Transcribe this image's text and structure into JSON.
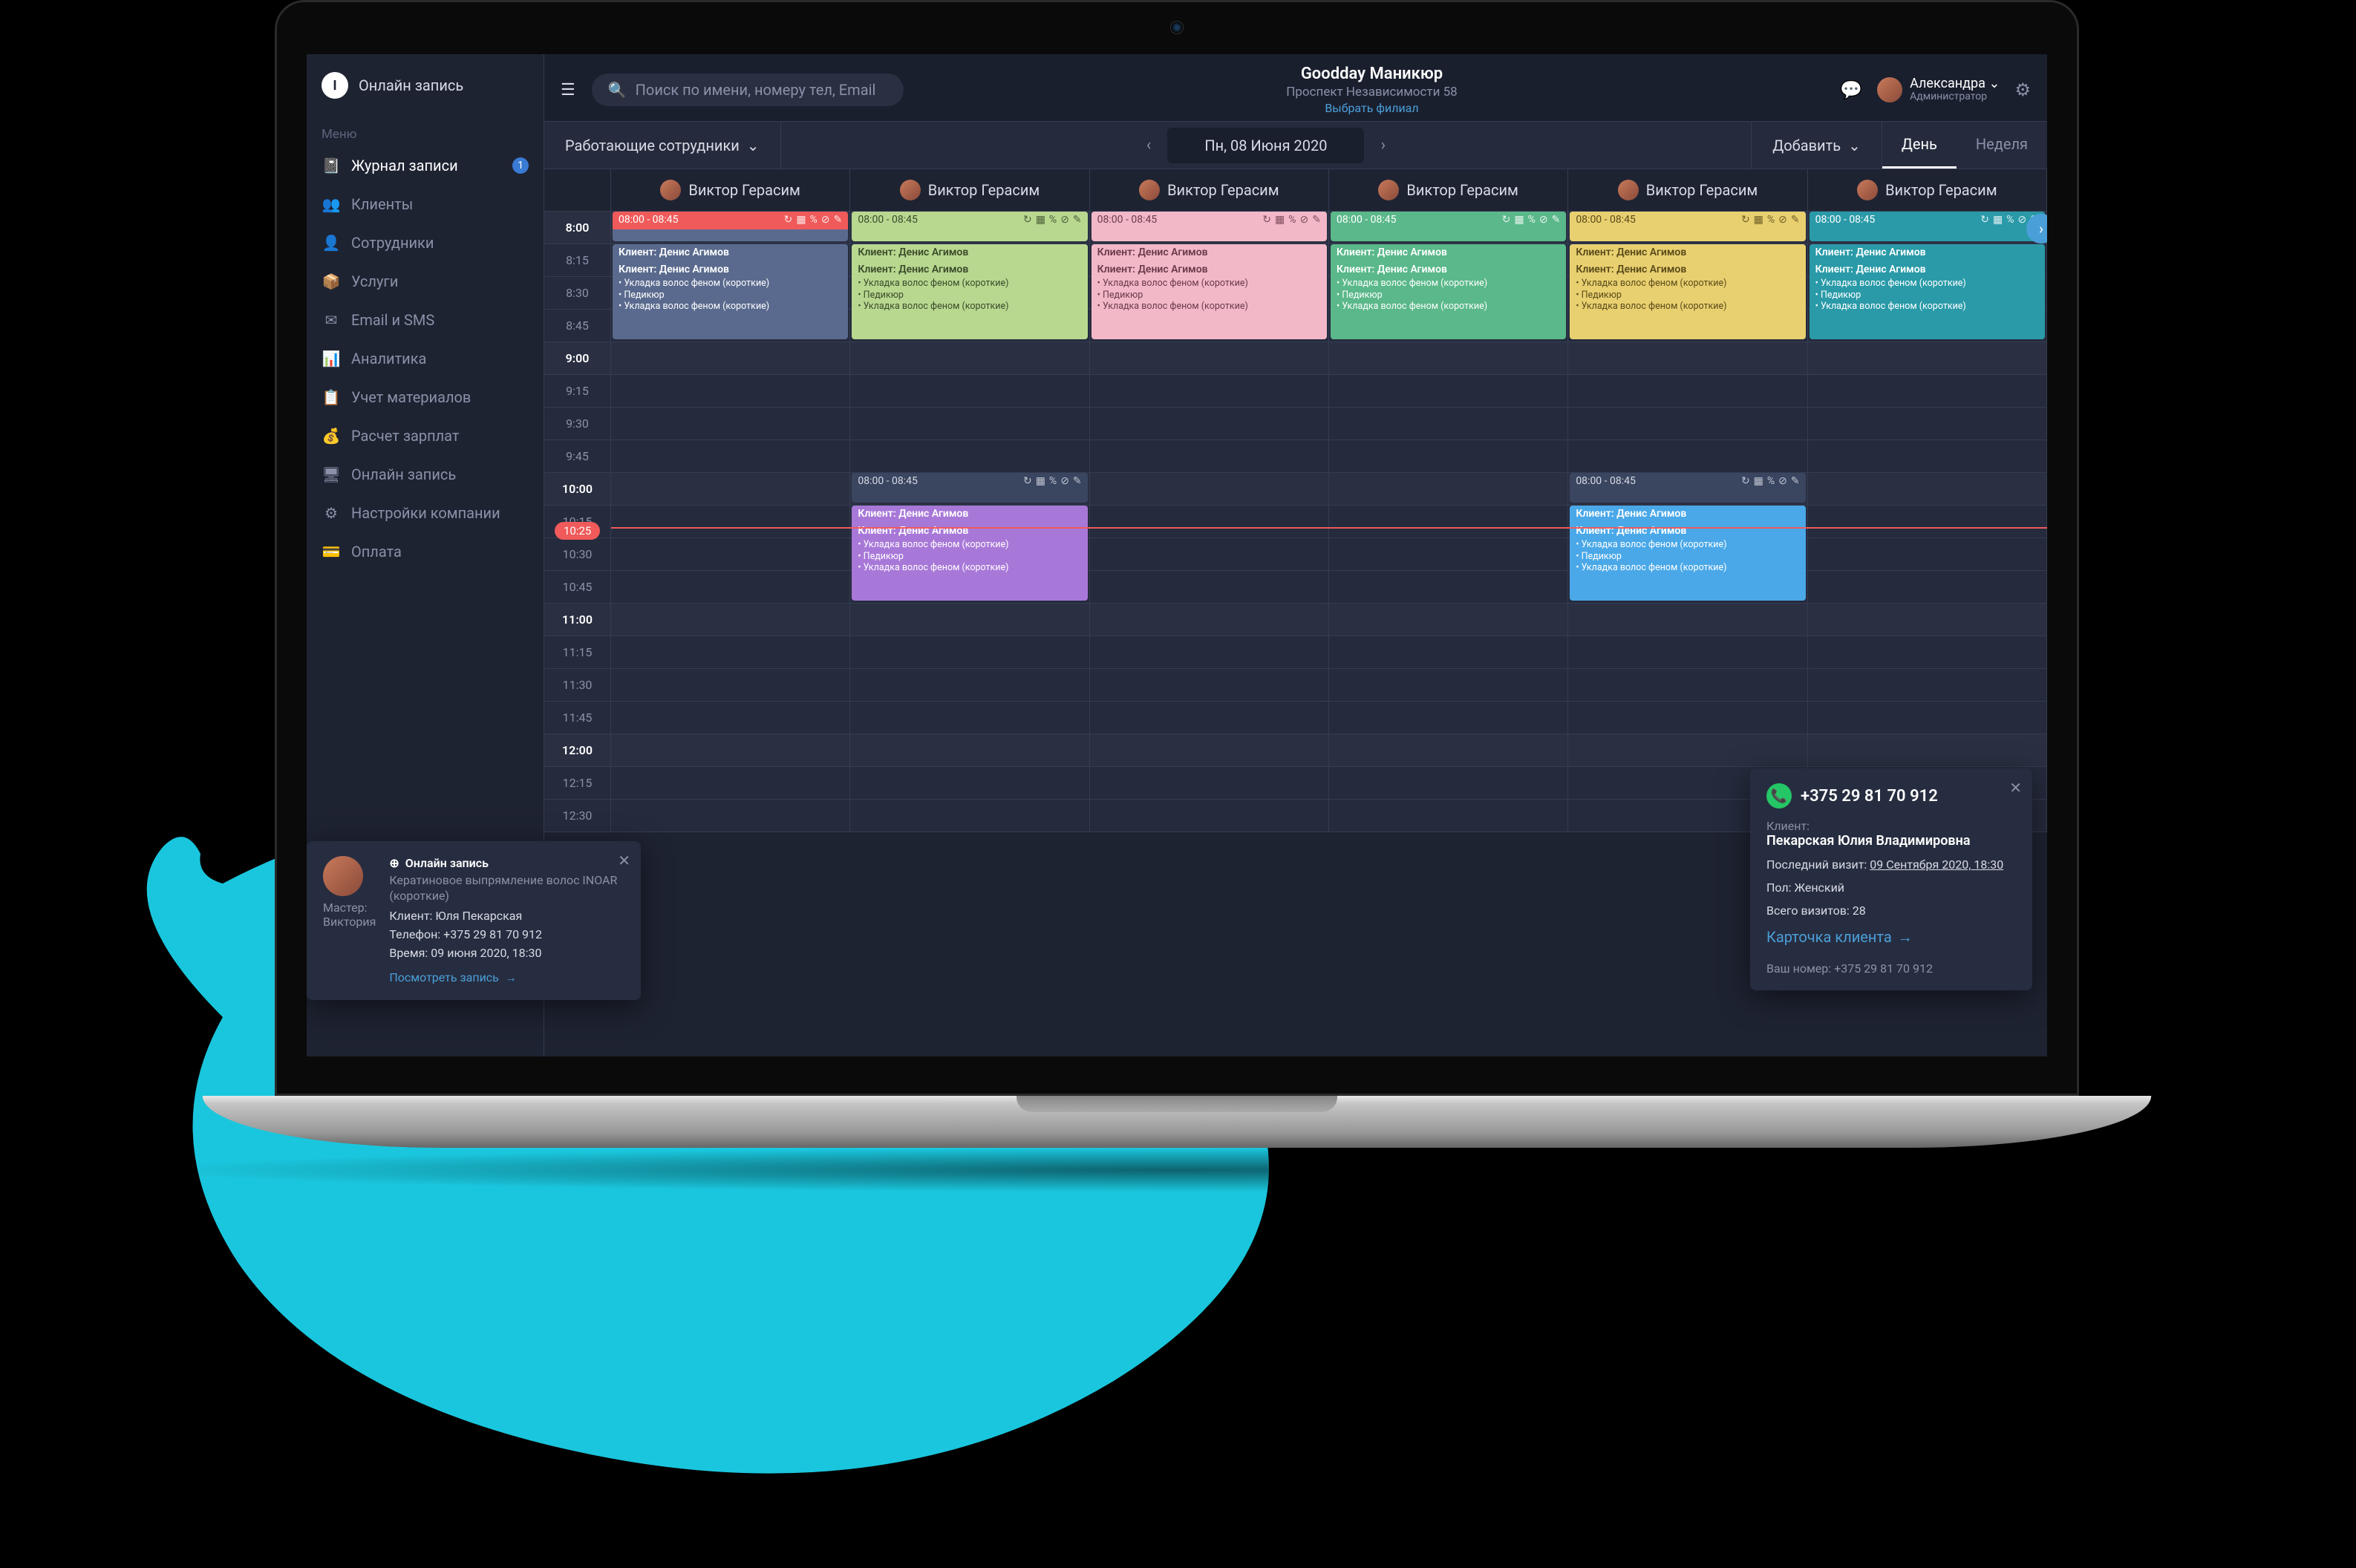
{
  "logo_text": "Онлайн запись",
  "menu_label": "Меню",
  "sidebar": {
    "items": [
      {
        "icon": "📓",
        "label": "Журнал записи",
        "badge": "1",
        "active": true
      },
      {
        "icon": "👥",
        "label": "Клиенты"
      },
      {
        "icon": "👤",
        "label": "Сотрудники"
      },
      {
        "icon": "📦",
        "label": "Услуги"
      },
      {
        "icon": "✉",
        "label": "Email и SMS"
      },
      {
        "icon": "📊",
        "label": "Аналитика"
      },
      {
        "icon": "📋",
        "label": "Учет материалов"
      },
      {
        "icon": "💰",
        "label": "Расчет зарплат"
      },
      {
        "icon": "🖥",
        "label": "Онлайн запись"
      },
      {
        "icon": "⚙",
        "label": "Настройки компании"
      },
      {
        "icon": "💳",
        "label": "Оплата"
      }
    ]
  },
  "search_placeholder": "Поиск по имени, номеру тел, Email",
  "brand": {
    "title": "Goodday Маникюр",
    "subtitle": "Проспект Независимости 58",
    "link": "Выбрать филиал"
  },
  "user": {
    "name": "Александра",
    "role": "Администратор"
  },
  "toolbar": {
    "staff_filter": "Работающие сотрудники",
    "date": "Пн, 08 Июня 2020",
    "add": "Добавить",
    "views": {
      "day": "День",
      "week": "Неделя",
      "active": "day"
    }
  },
  "staff_name": "Виктор Герасим",
  "time_labels": [
    "8:00",
    "8:15",
    "8:30",
    "8:45",
    "9:00",
    "9:15",
    "9:30",
    "9:45",
    "10:00",
    "10:15",
    "10:30",
    "10:45",
    "11:00",
    "11:15",
    "11:30",
    "11:45",
    "12:00",
    "12:15",
    "12:30"
  ],
  "now_time": "10:25",
  "appt_template": {
    "time": "08:00 - 08:45",
    "title": "Клиент: Денис Агимов",
    "lines": [
      "• Укладка волос феном (короткие)",
      "• Педикюр",
      "• Укладка волос феном (короткие)"
    ]
  },
  "appt_colors": [
    {
      "head": "#f05a5a",
      "body": "#5a6a8e",
      "text": "#fff",
      "is_red": true
    },
    {
      "head": "#b8d890",
      "body": "#b8d890",
      "text": "#3a4a2a"
    },
    {
      "head": "#f2b8c8",
      "body": "#f2b8c8",
      "text": "#6a3a4a"
    },
    {
      "head": "#5ab88a",
      "body": "#5ab88a",
      "text": "#fff"
    },
    {
      "head": "#e8d070",
      "body": "#e8d070",
      "text": "#5a4a1a"
    },
    {
      "head": "#2a9aa8",
      "body": "#2a9aa8",
      "text": "#fff"
    }
  ],
  "lower_appt_color": {
    "head": "#a878d8",
    "body": "#a878d8",
    "text": "#fff"
  },
  "lower_appt_color_alt": {
    "head": "#4aa8e8",
    "body": "#4aa8e8",
    "text": "#fff"
  },
  "popover_left": {
    "heading": "Онлайн запись",
    "service": "Кератиновое выпрямление волос INOAR (короткие)",
    "master_label": "Мастер:",
    "master_name": "Виктория",
    "client_label": "Клиент:",
    "client": "Юля Пекарская",
    "phone_label": "Телефон:",
    "phone": "+375 29 81 70 912",
    "time_label": "Время:",
    "time": "09 июня 2020, 18:30",
    "link": "Посмотреть запись"
  },
  "popover_right": {
    "phone": "+375 29 81 70 912",
    "client_label": "Клиент:",
    "client": "Пекарская Юлия Владимировна",
    "last_visit_label": "Последний визит:",
    "last_visit": "09 Сентября 2020, 18:30",
    "gender_label": "Пол:",
    "gender": "Женский",
    "visits_label": "Всего визитов:",
    "visits": "28",
    "card_link": "Карточка клиента",
    "your_number_label": "Ваш номер:",
    "your_number": "+375 29 81 70 912"
  }
}
